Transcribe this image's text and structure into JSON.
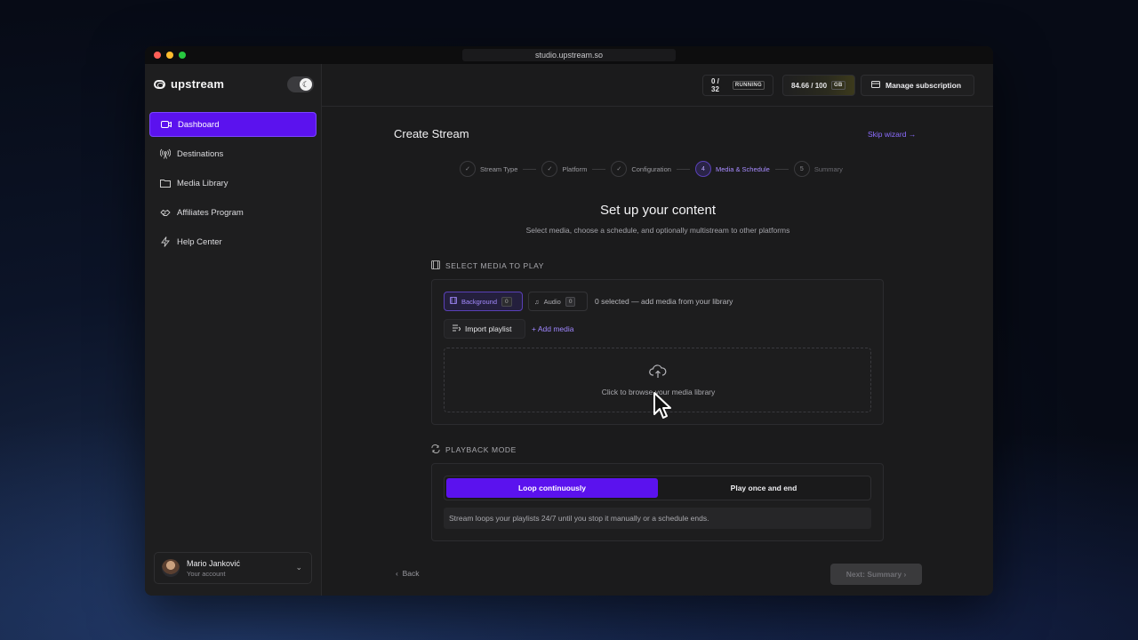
{
  "browser": {
    "url": "studio.upstream.so"
  },
  "brand": {
    "name": "upstream",
    "accent_color": "#5b12ee"
  },
  "sidebar": {
    "items": [
      {
        "label": "Dashboard",
        "icon": "video-camera-icon",
        "active": true
      },
      {
        "label": "Destinations",
        "icon": "broadcast-tower-icon",
        "active": false
      },
      {
        "label": "Media Library",
        "icon": "folder-icon",
        "active": false
      },
      {
        "label": "Affiliates Program",
        "icon": "handshake-icon",
        "active": false
      },
      {
        "label": "Help Center",
        "icon": "lightning-icon",
        "active": false
      }
    ],
    "account": {
      "name": "Mario Janković",
      "subtitle": "Your account"
    }
  },
  "topbar": {
    "running_count": "0 / 32",
    "running_badge": "RUNNING",
    "storage": "84.66 / 100",
    "storage_unit": "GB",
    "manage_label": "Manage subscription"
  },
  "main": {
    "title": "Create Stream",
    "skip_label": "Skip wizard →",
    "steps": [
      {
        "number": "✓",
        "label": "Stream Type",
        "state": "done"
      },
      {
        "number": "✓",
        "label": "Platform",
        "state": "done"
      },
      {
        "number": "✓",
        "label": "Configuration",
        "state": "done"
      },
      {
        "number": "4",
        "label": "Media & Schedule",
        "state": "current"
      },
      {
        "number": "5",
        "label": "Summary",
        "state": "upcoming"
      }
    ],
    "heading": "Set up your content",
    "subheading": "Select media, choose a schedule, and optionally multistream to other platforms"
  },
  "media": {
    "section_label": "SELECT MEDIA TO PLAY",
    "tabs": [
      {
        "label": "Background",
        "count": "0"
      },
      {
        "label": "Audio",
        "count": "0"
      }
    ],
    "selected_text": "0 selected — add media from your library",
    "import_label": "Import playlist",
    "add_label": "+ Add media",
    "dropzone_text": "Click to browse your media library"
  },
  "playback": {
    "section_label": "PLAYBACK MODE",
    "options": [
      "Loop continuously",
      "Play once and end"
    ],
    "selected": "Loop continuously",
    "description": "Stream loops your playlists 24/7 until you stop it manually or a schedule ends."
  },
  "footer": {
    "back_label": "Back",
    "next_label": "Next: Summary"
  }
}
